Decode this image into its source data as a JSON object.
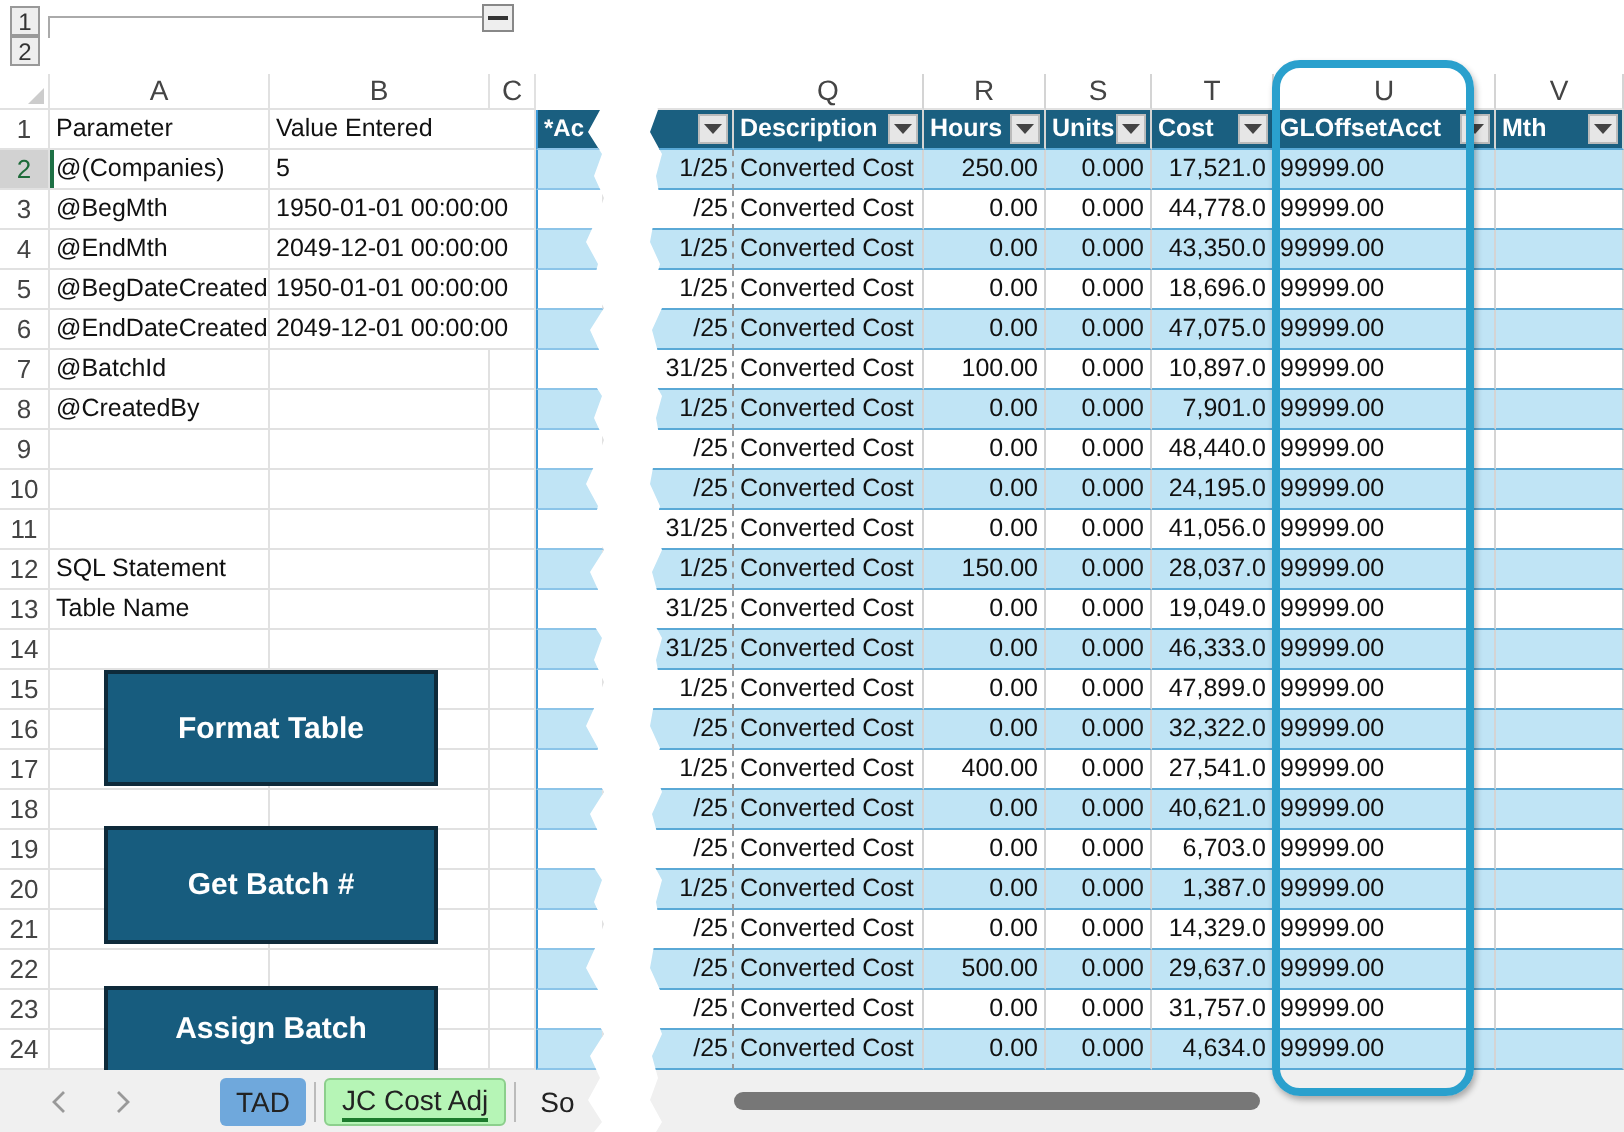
{
  "outline": {
    "levels": [
      "1",
      "2"
    ]
  },
  "left_sheet": {
    "columns": [
      "A",
      "B",
      "C"
    ],
    "table_header": "*Ac",
    "rows": [
      {
        "number": "1",
        "parameter": "Parameter",
        "value": "Value Entered",
        "selected": false
      },
      {
        "number": "2",
        "parameter": "@(Companies)",
        "value": "5",
        "selected": true
      },
      {
        "number": "3",
        "parameter": "@BegMth",
        "value": "1950-01-01 00:00:00",
        "selected": false
      },
      {
        "number": "4",
        "parameter": "@EndMth",
        "value": "2049-12-01 00:00:00",
        "selected": false
      },
      {
        "number": "5",
        "parameter": "@BegDateCreated",
        "value": "1950-01-01 00:00:00",
        "selected": false
      },
      {
        "number": "6",
        "parameter": "@EndDateCreated",
        "value": "2049-12-01 00:00:00",
        "selected": false
      },
      {
        "number": "7",
        "parameter": "@BatchId",
        "selected": false
      },
      {
        "number": "8",
        "parameter": "@CreatedBy",
        "selected": false
      },
      {
        "number": "9",
        "selected": false
      },
      {
        "number": "10",
        "selected": false
      },
      {
        "number": "11",
        "selected": false
      },
      {
        "number": "12",
        "parameter": "SQL Statement",
        "selected": false
      },
      {
        "number": "13",
        "parameter": "Table Name",
        "selected": false
      },
      {
        "number": "14",
        "selected": false
      },
      {
        "number": "15",
        "selected": false
      },
      {
        "number": "16",
        "selected": false
      },
      {
        "number": "17",
        "selected": false
      },
      {
        "number": "18",
        "selected": false
      },
      {
        "number": "19",
        "selected": false
      },
      {
        "number": "20",
        "selected": false
      },
      {
        "number": "21",
        "selected": false
      },
      {
        "number": "22",
        "selected": false
      },
      {
        "number": "23",
        "selected": false
      },
      {
        "number": "24",
        "selected": false
      }
    ],
    "buttons": [
      "Format Table",
      "Get Batch #",
      "Assign Batch"
    ]
  },
  "sheet_tabs": [
    {
      "label": "TAD",
      "selected": false,
      "color": "#6fa8dc"
    },
    {
      "label": "JC Cost Adj",
      "selected": true,
      "color": "#b6f5b6"
    },
    {
      "label": "So",
      "selected": false
    }
  ],
  "right_sheet": {
    "columns": [
      {
        "letter": "Q",
        "header": "Description",
        "kind": "text",
        "highlighted": false
      },
      {
        "letter": "R",
        "header": "Hours",
        "kind": "number",
        "highlighted": false
      },
      {
        "letter": "S",
        "header": "Units",
        "kind": "number",
        "highlighted": false
      },
      {
        "letter": "T",
        "header": "Cost",
        "kind": "number",
        "highlighted": false
      },
      {
        "letter": "U",
        "header": "GLOffsetAcct",
        "kind": "text",
        "highlighted": true
      },
      {
        "letter": "V",
        "header": "Mth",
        "kind": "text",
        "highlighted": false
      }
    ],
    "rows": [
      {
        "date": "1/25",
        "cells": [
          "Converted Cost",
          "250.00",
          "0.000",
          "17,521.0",
          "99999.00"
        ]
      },
      {
        "date": "/25",
        "cells": [
          "Converted Cost",
          "0.00",
          "0.000",
          "44,778.0",
          "99999.00"
        ]
      },
      {
        "date": "1/25",
        "cells": [
          "Converted Cost",
          "0.00",
          "0.000",
          "43,350.0",
          "99999.00"
        ]
      },
      {
        "date": "1/25",
        "cells": [
          "Converted Cost",
          "0.00",
          "0.000",
          "18,696.0",
          "99999.00"
        ]
      },
      {
        "date": "/25",
        "cells": [
          "Converted Cost",
          "0.00",
          "0.000",
          "47,075.0",
          "99999.00"
        ]
      },
      {
        "date": "31/25",
        "cells": [
          "Converted Cost",
          "100.00",
          "0.000",
          "10,897.0",
          "99999.00"
        ]
      },
      {
        "date": "1/25",
        "cells": [
          "Converted Cost",
          "0.00",
          "0.000",
          "7,901.0",
          "99999.00"
        ]
      },
      {
        "date": "/25",
        "cells": [
          "Converted Cost",
          "0.00",
          "0.000",
          "48,440.0",
          "99999.00"
        ]
      },
      {
        "date": "/25",
        "cells": [
          "Converted Cost",
          "0.00",
          "0.000",
          "24,195.0",
          "99999.00"
        ]
      },
      {
        "date": "31/25",
        "cells": [
          "Converted Cost",
          "0.00",
          "0.000",
          "41,056.0",
          "99999.00"
        ]
      },
      {
        "date": "1/25",
        "cells": [
          "Converted Cost",
          "150.00",
          "0.000",
          "28,037.0",
          "99999.00"
        ]
      },
      {
        "date": "31/25",
        "cells": [
          "Converted Cost",
          "0.00",
          "0.000",
          "19,049.0",
          "99999.00"
        ]
      },
      {
        "date": "31/25",
        "cells": [
          "Converted Cost",
          "0.00",
          "0.000",
          "46,333.0",
          "99999.00"
        ]
      },
      {
        "date": "1/25",
        "cells": [
          "Converted Cost",
          "0.00",
          "0.000",
          "47,899.0",
          "99999.00"
        ]
      },
      {
        "date": "/25",
        "cells": [
          "Converted Cost",
          "0.00",
          "0.000",
          "32,322.0",
          "99999.00"
        ]
      },
      {
        "date": "1/25",
        "cells": [
          "Converted Cost",
          "400.00",
          "0.000",
          "27,541.0",
          "99999.00"
        ]
      },
      {
        "date": "/25",
        "cells": [
          "Converted Cost",
          "0.00",
          "0.000",
          "40,621.0",
          "99999.00"
        ]
      },
      {
        "date": "/25",
        "cells": [
          "Converted Cost",
          "0.00",
          "0.000",
          "6,703.0",
          "99999.00"
        ]
      },
      {
        "date": "1/25",
        "cells": [
          "Converted Cost",
          "0.00",
          "0.000",
          "1,387.0",
          "99999.00"
        ]
      },
      {
        "date": "/25",
        "cells": [
          "Converted Cost",
          "0.00",
          "0.000",
          "14,329.0",
          "99999.00"
        ]
      },
      {
        "date": "/25",
        "cells": [
          "Converted Cost",
          "500.00",
          "0.000",
          "29,637.0",
          "99999.00"
        ]
      },
      {
        "date": "/25",
        "cells": [
          "Converted Cost",
          "0.00",
          "0.000",
          "31,757.0",
          "99999.00"
        ]
      },
      {
        "date": "/25",
        "cells": [
          "Converted Cost",
          "0.00",
          "0.000",
          "4,634.0",
          "99999.00"
        ]
      }
    ]
  }
}
